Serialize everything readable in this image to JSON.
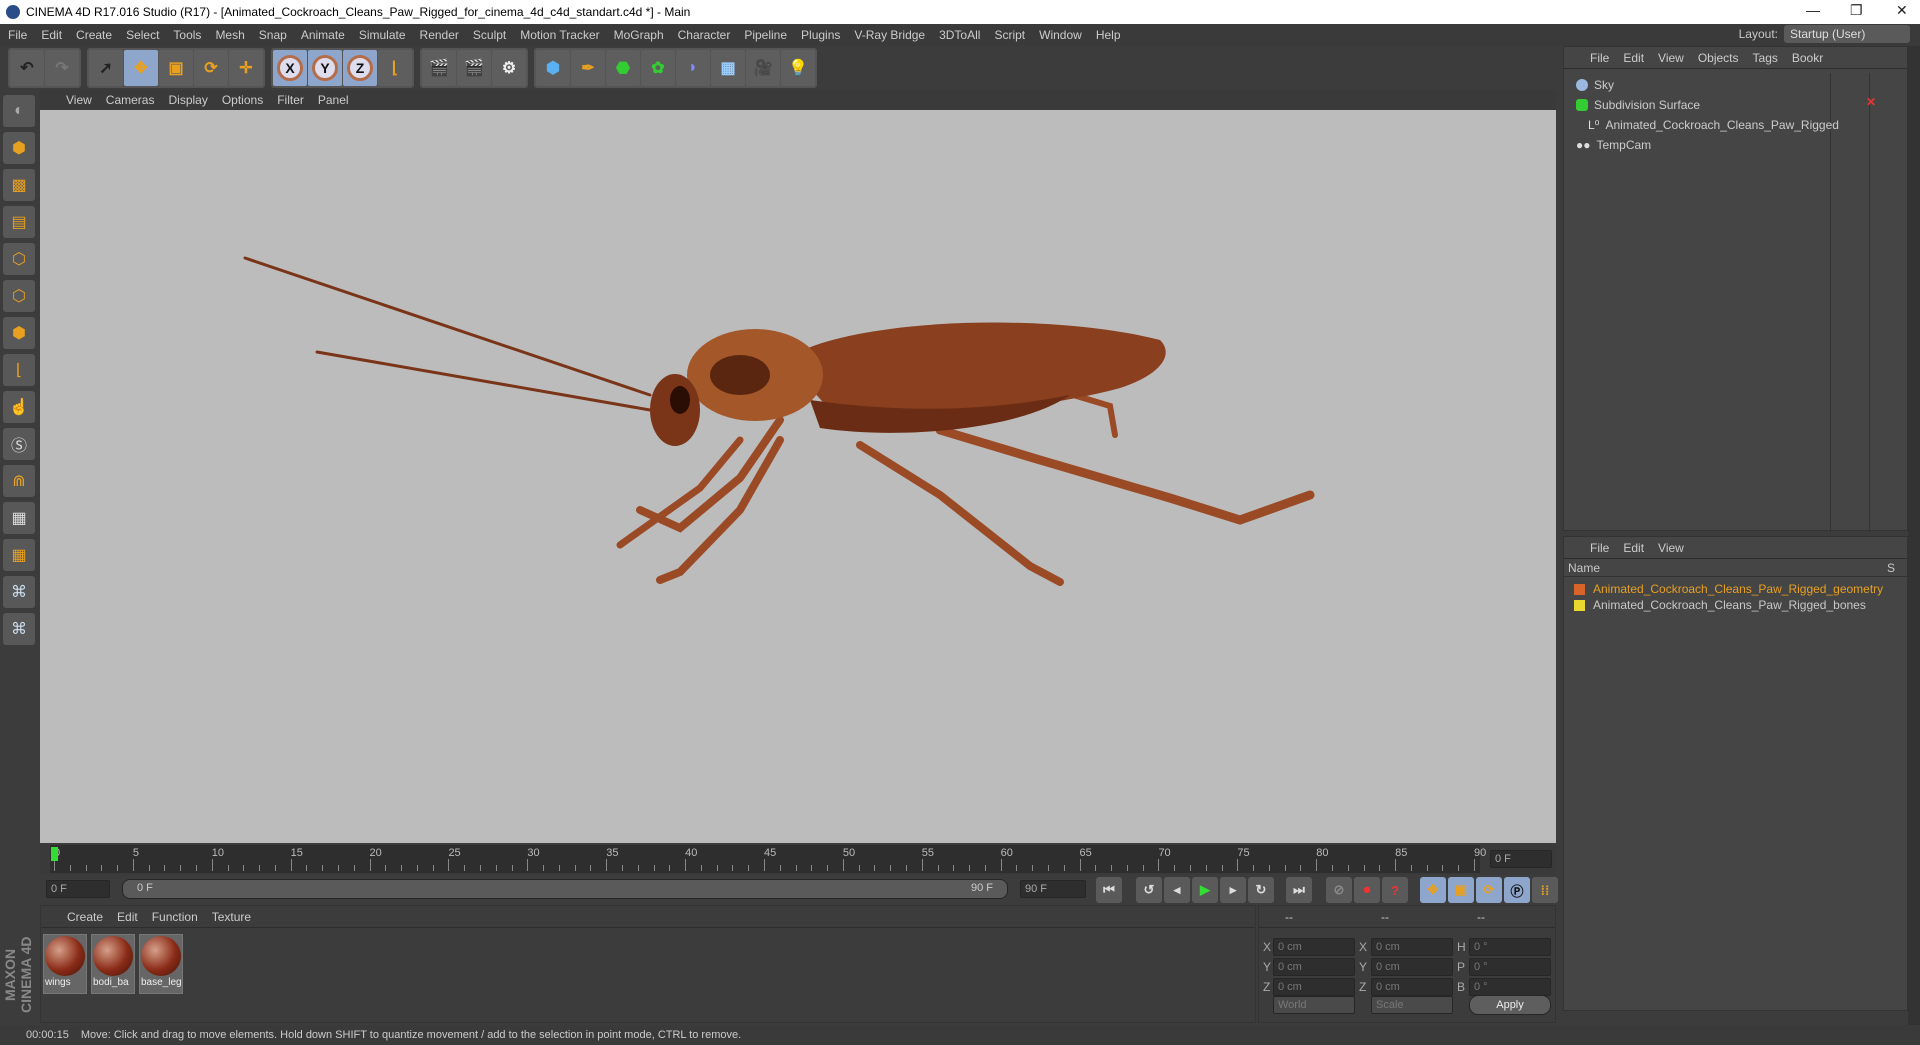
{
  "window": {
    "title": "CINEMA 4D R17.016 Studio (R17) - [Animated_Cockroach_Cleans_Paw_Rigged_for_cinema_4d_c4d_standart.c4d *] - Main",
    "minimize": "—",
    "restore": "❐",
    "close": "✕"
  },
  "menu": [
    "File",
    "Edit",
    "Create",
    "Select",
    "Tools",
    "Mesh",
    "Snap",
    "Animate",
    "Simulate",
    "Render",
    "Sculpt",
    "Motion Tracker",
    "MoGraph",
    "Character",
    "Pipeline",
    "Plugins",
    "V-Ray Bridge",
    "3DToAll",
    "Script",
    "Window",
    "Help"
  ],
  "layout": {
    "label": "Layout:",
    "value": "Startup (User)"
  },
  "toolbar": {
    "axes": [
      "X",
      "Y",
      "Z"
    ]
  },
  "viewport_menu": [
    "View",
    "Cameras",
    "Display",
    "Options",
    "Filter",
    "Panel"
  ],
  "timeline": {
    "ticks": [
      "0",
      "5",
      "10",
      "15",
      "20",
      "25",
      "30",
      "35",
      "40",
      "45",
      "50",
      "55",
      "60",
      "65",
      "70",
      "75",
      "80",
      "85",
      "90"
    ],
    "current_frame": "0 F",
    "start": "0 F",
    "range_start": "0 F",
    "range_end": "90 F",
    "end": "90 F",
    "progress": 0
  },
  "materials": {
    "menu": [
      "Create",
      "Edit",
      "Function",
      "Texture"
    ],
    "items": [
      "wings",
      "bodi_ba",
      "base_leg"
    ]
  },
  "coords": {
    "headers": [
      "--",
      "--",
      "--"
    ],
    "rows": [
      {
        "a": "X",
        "pos": "0 cm",
        "b": "X",
        "size": "0 cm",
        "c": "H",
        "rot": "0 °"
      },
      {
        "a": "Y",
        "pos": "0 cm",
        "b": "Y",
        "size": "0 cm",
        "c": "P",
        "rot": "0 °"
      },
      {
        "a": "Z",
        "pos": "0 cm",
        "b": "Z",
        "size": "0 cm",
        "c": "B",
        "rot": "0 °"
      }
    ],
    "world": "World",
    "scale": "Scale",
    "apply": "Apply"
  },
  "objects": {
    "menu": [
      "File",
      "Edit",
      "View",
      "Objects",
      "Tags",
      "Bookr"
    ],
    "items": [
      "Sky",
      "Subdivision Surface",
      "Animated_Cockroach_Cleans_Paw_Rigged",
      "TempCam"
    ]
  },
  "layers": {
    "menu": [
      "File",
      "Edit",
      "View"
    ],
    "col_name": "Name",
    "col_s": "S",
    "items": [
      {
        "name": "Animated_Cockroach_Cleans_Paw_Rigged_geometry",
        "color": "#d8642a"
      },
      {
        "name": "Animated_Cockroach_Cleans_Paw_Rigged_bones",
        "color": "#e8d830"
      }
    ]
  },
  "brand": "MAXON CINEMA 4D",
  "status": {
    "time": "00:00:15",
    "message": "Move: Click and drag to move elements. Hold down SHIFT to quantize movement / add to the selection in point mode, CTRL to remove."
  }
}
